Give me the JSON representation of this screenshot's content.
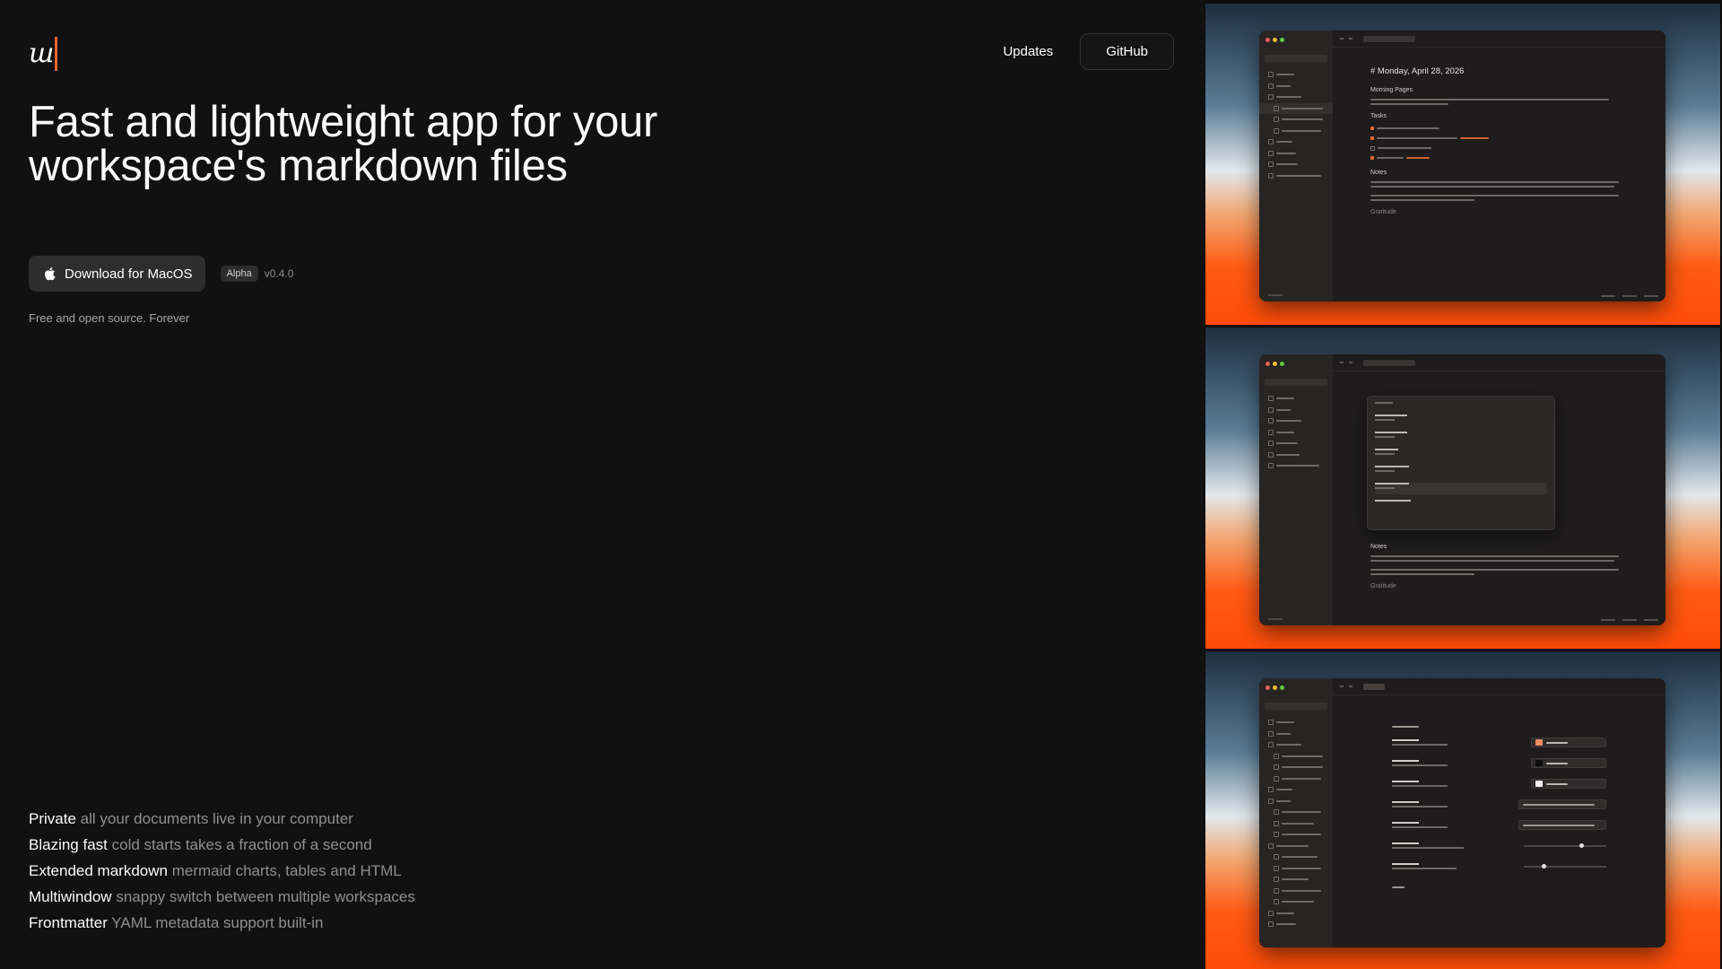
{
  "brand": {
    "logo_text": "ш",
    "accent_color": "#e8652b"
  },
  "nav": {
    "updates_label": "Updates",
    "github_label": "GitHub"
  },
  "hero": {
    "title": "Fast and lightweight app for your workspace's markdown files",
    "download_label": "Download for MacOS",
    "badge": "Alpha",
    "version": "v0.4.0",
    "tagline": "Free and open source. Forever"
  },
  "features": [
    {
      "title": "Private",
      "desc": "all your documents live in your computer"
    },
    {
      "title": "Blazing fast",
      "desc": "cold starts takes a fraction of a second"
    },
    {
      "title": "Extended markdown",
      "desc": "mermaid charts, tables and HTML"
    },
    {
      "title": "Multiwindow",
      "desc": "snappy switch between multiple workspaces"
    },
    {
      "title": "Frontmatter",
      "desc": "YAML metadata support built-in"
    }
  ],
  "screenshots": {
    "s1": {
      "doc_title": "# Monday, April 28, 2026",
      "h_morning": "Morning Pages",
      "h_tasks": "Tasks",
      "h_notes": "Notes",
      "h_gratitude": "Gratitude"
    },
    "s2": {
      "h_notes": "Notes",
      "h_gratitude": "Gratitude"
    },
    "s3": {}
  },
  "colors": {
    "background": "#111111",
    "button_bg": "#2e2e2e",
    "muted_text": "#8f8f8f"
  }
}
